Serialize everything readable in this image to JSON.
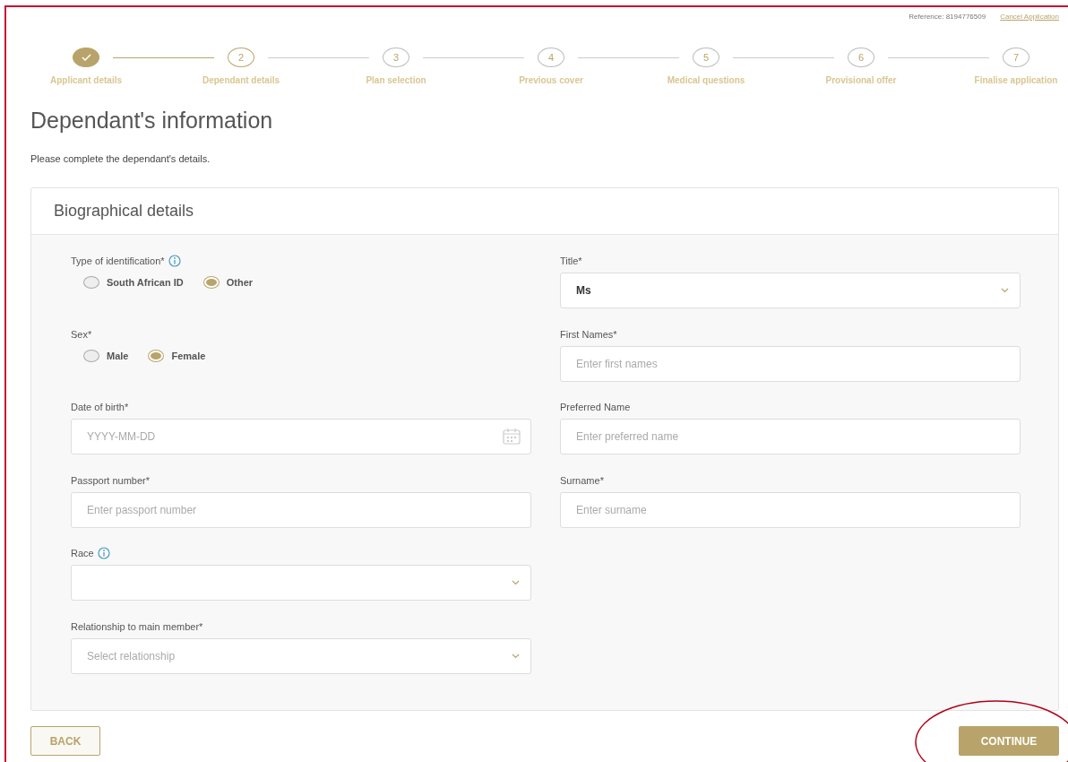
{
  "header": {
    "reference": "Reference: 8194776509",
    "cancel_link": "Cancel Application"
  },
  "steps": [
    {
      "label": "Applicant details",
      "done": true,
      "current": false
    },
    {
      "number": "2",
      "label": "Dependant details",
      "done": false,
      "current": true
    },
    {
      "number": "3",
      "label": "Plan selection",
      "done": false,
      "current": false
    },
    {
      "number": "4",
      "label": "Previous cover",
      "done": false,
      "current": false
    },
    {
      "number": "5",
      "label": "Medical questions",
      "done": false,
      "current": false
    },
    {
      "number": "6",
      "label": "Provisional offer",
      "done": false,
      "current": false
    },
    {
      "number": "7",
      "label": "Finalise application",
      "done": false,
      "current": false
    }
  ],
  "title": "Dependant's information",
  "subtitle": "Please complete the dependant's details.",
  "card": {
    "title": "Biographical details",
    "left_fields": [
      {
        "kind": "radio",
        "label": "Type of identification*",
        "info": true,
        "options": [
          {
            "label": "South African ID",
            "selected": false
          },
          {
            "label": "Other",
            "selected": true
          }
        ]
      },
      {
        "kind": "radio",
        "label": "Sex*",
        "info": false,
        "options": [
          {
            "label": "Male",
            "selected": false
          },
          {
            "label": "Female",
            "selected": true
          }
        ]
      },
      {
        "kind": "date",
        "label": "Date of birth*",
        "info": false,
        "placeholder": "YYYY-MM-DD"
      },
      {
        "kind": "text",
        "label": "Passport number*",
        "info": false,
        "placeholder": "Enter passport number"
      },
      {
        "kind": "select",
        "label": "Race",
        "info": true
      },
      {
        "kind": "select",
        "label": "Relationship to main member*",
        "info": false,
        "placeholder": "Select relationship"
      }
    ],
    "right_fields": [
      {
        "kind": "select",
        "label": "Title*",
        "info": false,
        "value": "Ms"
      },
      {
        "kind": "text",
        "label": "First Names*",
        "info": false,
        "placeholder": "Enter first names"
      },
      {
        "kind": "text",
        "label": "Preferred Name",
        "info": false,
        "placeholder": "Enter preferred name"
      },
      {
        "kind": "text",
        "label": "Surname*",
        "info": false,
        "placeholder": "Enter surname"
      }
    ]
  },
  "buttons": {
    "back": "BACK",
    "continue": "CONTINUE"
  }
}
